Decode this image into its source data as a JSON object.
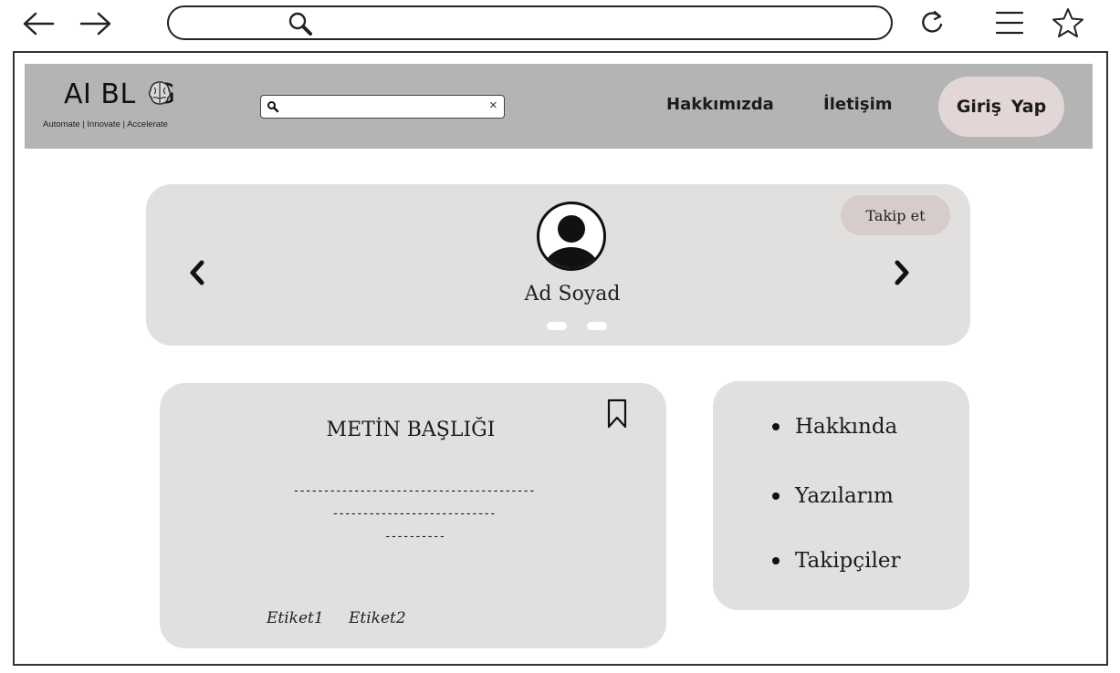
{
  "site": {
    "logo": "AI BL  G",
    "tagline": "Automate | Innovate | Accelerate",
    "nav": {
      "about": "Hakkımızda",
      "contact": "İletişim",
      "login": "Giriş Yap"
    },
    "search": {
      "clear": "×"
    }
  },
  "profile": {
    "name": "Ad Soyad",
    "follow_label": "Takip et",
    "prev_label": "‹",
    "next_label": "›"
  },
  "article": {
    "title": "METİN BAŞLIĞI",
    "body_lines": [
      "----------------------------------------",
      "---------------------------",
      "----------"
    ],
    "tags": [
      "Etiket1",
      "Etiket2"
    ]
  },
  "menu": {
    "items": [
      "Hakkında",
      "Yazılarım",
      "Takipçiler"
    ]
  }
}
